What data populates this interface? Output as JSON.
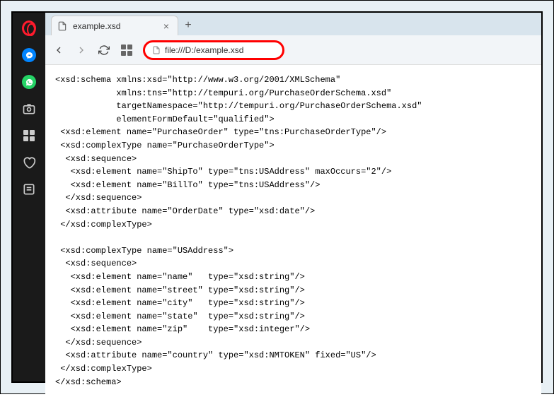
{
  "tab": {
    "title": "example.xsd"
  },
  "address": {
    "url": "file:///D:/example.xsd"
  },
  "content": {
    "text": "<xsd:schema xmlns:xsd=\"http://www.w3.org/2001/XMLSchema\"\n            xmlns:tns=\"http://tempuri.org/PurchaseOrderSchema.xsd\"\n            targetNamespace=\"http://tempuri.org/PurchaseOrderSchema.xsd\"\n            elementFormDefault=\"qualified\">\n <xsd:element name=\"PurchaseOrder\" type=\"tns:PurchaseOrderType\"/>\n <xsd:complexType name=\"PurchaseOrderType\">\n  <xsd:sequence>\n   <xsd:element name=\"ShipTo\" type=\"tns:USAddress\" maxOccurs=\"2\"/>\n   <xsd:element name=\"BillTo\" type=\"tns:USAddress\"/>\n  </xsd:sequence>\n  <xsd:attribute name=\"OrderDate\" type=\"xsd:date\"/>\n </xsd:complexType>\n\n <xsd:complexType name=\"USAddress\">\n  <xsd:sequence>\n   <xsd:element name=\"name\"   type=\"xsd:string\"/>\n   <xsd:element name=\"street\" type=\"xsd:string\"/>\n   <xsd:element name=\"city\"   type=\"xsd:string\"/>\n   <xsd:element name=\"state\"  type=\"xsd:string\"/>\n   <xsd:element name=\"zip\"    type=\"xsd:integer\"/>\n  </xsd:sequence>\n  <xsd:attribute name=\"country\" type=\"xsd:NMTOKEN\" fixed=\"US\"/>\n </xsd:complexType>\n</xsd:schema>"
  }
}
